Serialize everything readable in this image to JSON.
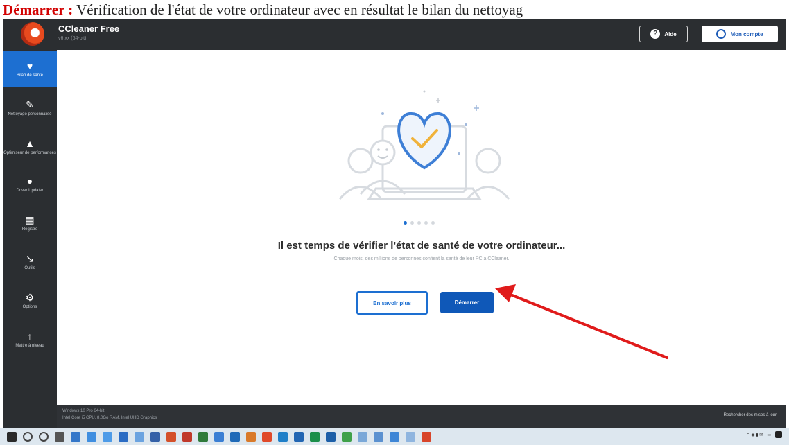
{
  "caption": {
    "keyword": "Démarrer :",
    "text": " Vérification de l'état de votre ordinateur avec en résultat le bilan du nettoyag"
  },
  "app": {
    "title": "CCleaner Free",
    "subtitle": "v6.xx (64-bit)"
  },
  "header": {
    "help_label": "Aide",
    "account_label": "Mon compte"
  },
  "sidebar": {
    "items": [
      {
        "label": "Bilan de santé",
        "icon": "heart-icon"
      },
      {
        "label": "Nettoyage personnalisé",
        "icon": "broom-icon"
      },
      {
        "label": "Optimiseur de performances",
        "icon": "rocket-icon"
      },
      {
        "label": "Driver Updater",
        "icon": "gear-circle-icon"
      },
      {
        "label": "Registre",
        "icon": "grid-icon"
      },
      {
        "label": "Outils",
        "icon": "wrench-icon"
      },
      {
        "label": "Options",
        "icon": "settings-icon"
      },
      {
        "label": "Mettre à niveau",
        "icon": "upgrade-arrow-icon"
      }
    ]
  },
  "main": {
    "headline": "Il est temps de vérifier l'état de santé de votre ordinateur...",
    "subline": "Chaque mois, des millions de personnes confient la santé de leur PC à CCleaner.",
    "learn_more_label": "En savoir plus",
    "start_label": "Démarrer",
    "pager": {
      "total": 5,
      "active": 1
    }
  },
  "footer": {
    "line1": "Windows 10 Pro 64-bit",
    "line2": "Intel Core i5 CPU, 8,0Go RAM, Intel UHD Graphics",
    "right": "Rechercher des mises à jour"
  },
  "colors": {
    "accent": "#1d6fd1",
    "annotation": "#e01b1b",
    "caption_keyword": "#d20000"
  }
}
